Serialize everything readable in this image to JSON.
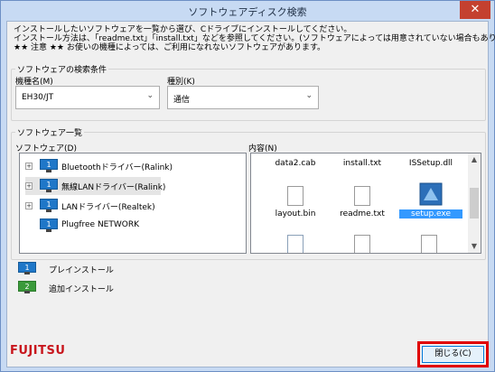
{
  "window": {
    "title": "ソフトウェアディスク検索",
    "close_glyph": "✕"
  },
  "info": {
    "line1": "インストールしたいソフトウェアを一覧から選び、Cドライブにインストールしてください。",
    "line2": "インストール方法は、「readme.txt」「install.txt」などを参照してください。(ソフトウェアによっては用意されていない場合もあります)",
    "line3": "★★ 注意 ★★ お使いの機種によっては、ご利用になれないソフトウェアがあります。"
  },
  "search": {
    "group_title": "ソフトウェアの検索条件",
    "model_label": "機種名(M)",
    "model_value": "EH30/JT",
    "kind_label": "種別(K)",
    "kind_value": "通信"
  },
  "list": {
    "group_title": "ソフトウェア一覧",
    "software_label": "ソフトウェア(D)",
    "contents_label": "内容(N)",
    "items": [
      {
        "label": "Bluetoothドライバー(Ralink)",
        "icon": "monitor-icon",
        "badge": "1",
        "color": "#1f77c8"
      },
      {
        "label": "無線LANドライバー(Ralink)",
        "icon": "monitor-icon",
        "badge": "1",
        "color": "#1f77c8"
      },
      {
        "label": "LANドライバー(Realtek)",
        "icon": "monitor-icon",
        "badge": "1",
        "color": "#1f77c8"
      },
      {
        "label": "Plugfree NETWORK",
        "icon": "monitor-icon",
        "badge": "1",
        "color": "#1f77c8"
      }
    ],
    "files": [
      {
        "name": "data2.cab"
      },
      {
        "name": "install.txt"
      },
      {
        "name": "ISSetup.dll"
      },
      {
        "name": "layout.bin"
      },
      {
        "name": "readme.txt"
      },
      {
        "name": "setup.exe"
      }
    ]
  },
  "legend": [
    {
      "badge": "1",
      "label": "プレインストール",
      "color": "#1f77c8"
    },
    {
      "badge": "2",
      "label": "追加インストール",
      "color": "#3a9a3a"
    }
  ],
  "footer": {
    "brand": "FUJITSU",
    "close_label": "閉じる(C)"
  }
}
